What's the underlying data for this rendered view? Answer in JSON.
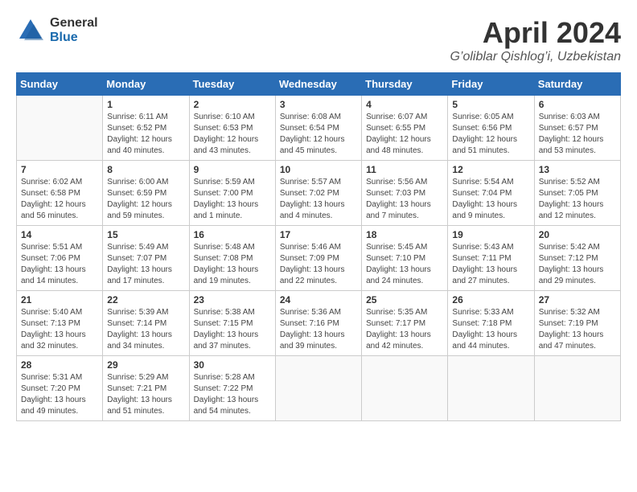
{
  "header": {
    "logo_general": "General",
    "logo_blue": "Blue",
    "month": "April 2024",
    "location": "G’oliblar Qishlog’i, Uzbekistan"
  },
  "days_of_week": [
    "Sunday",
    "Monday",
    "Tuesday",
    "Wednesday",
    "Thursday",
    "Friday",
    "Saturday"
  ],
  "weeks": [
    [
      {
        "day": "",
        "info": ""
      },
      {
        "day": "1",
        "info": "Sunrise: 6:11 AM\nSunset: 6:52 PM\nDaylight: 12 hours\nand 40 minutes."
      },
      {
        "day": "2",
        "info": "Sunrise: 6:10 AM\nSunset: 6:53 PM\nDaylight: 12 hours\nand 43 minutes."
      },
      {
        "day": "3",
        "info": "Sunrise: 6:08 AM\nSunset: 6:54 PM\nDaylight: 12 hours\nand 45 minutes."
      },
      {
        "day": "4",
        "info": "Sunrise: 6:07 AM\nSunset: 6:55 PM\nDaylight: 12 hours\nand 48 minutes."
      },
      {
        "day": "5",
        "info": "Sunrise: 6:05 AM\nSunset: 6:56 PM\nDaylight: 12 hours\nand 51 minutes."
      },
      {
        "day": "6",
        "info": "Sunrise: 6:03 AM\nSunset: 6:57 PM\nDaylight: 12 hours\nand 53 minutes."
      }
    ],
    [
      {
        "day": "7",
        "info": "Sunrise: 6:02 AM\nSunset: 6:58 PM\nDaylight: 12 hours\nand 56 minutes."
      },
      {
        "day": "8",
        "info": "Sunrise: 6:00 AM\nSunset: 6:59 PM\nDaylight: 12 hours\nand 59 minutes."
      },
      {
        "day": "9",
        "info": "Sunrise: 5:59 AM\nSunset: 7:00 PM\nDaylight: 13 hours\nand 1 minute."
      },
      {
        "day": "10",
        "info": "Sunrise: 5:57 AM\nSunset: 7:02 PM\nDaylight: 13 hours\nand 4 minutes."
      },
      {
        "day": "11",
        "info": "Sunrise: 5:56 AM\nSunset: 7:03 PM\nDaylight: 13 hours\nand 7 minutes."
      },
      {
        "day": "12",
        "info": "Sunrise: 5:54 AM\nSunset: 7:04 PM\nDaylight: 13 hours\nand 9 minutes."
      },
      {
        "day": "13",
        "info": "Sunrise: 5:52 AM\nSunset: 7:05 PM\nDaylight: 13 hours\nand 12 minutes."
      }
    ],
    [
      {
        "day": "14",
        "info": "Sunrise: 5:51 AM\nSunset: 7:06 PM\nDaylight: 13 hours\nand 14 minutes."
      },
      {
        "day": "15",
        "info": "Sunrise: 5:49 AM\nSunset: 7:07 PM\nDaylight: 13 hours\nand 17 minutes."
      },
      {
        "day": "16",
        "info": "Sunrise: 5:48 AM\nSunset: 7:08 PM\nDaylight: 13 hours\nand 19 minutes."
      },
      {
        "day": "17",
        "info": "Sunrise: 5:46 AM\nSunset: 7:09 PM\nDaylight: 13 hours\nand 22 minutes."
      },
      {
        "day": "18",
        "info": "Sunrise: 5:45 AM\nSunset: 7:10 PM\nDaylight: 13 hours\nand 24 minutes."
      },
      {
        "day": "19",
        "info": "Sunrise: 5:43 AM\nSunset: 7:11 PM\nDaylight: 13 hours\nand 27 minutes."
      },
      {
        "day": "20",
        "info": "Sunrise: 5:42 AM\nSunset: 7:12 PM\nDaylight: 13 hours\nand 29 minutes."
      }
    ],
    [
      {
        "day": "21",
        "info": "Sunrise: 5:40 AM\nSunset: 7:13 PM\nDaylight: 13 hours\nand 32 minutes."
      },
      {
        "day": "22",
        "info": "Sunrise: 5:39 AM\nSunset: 7:14 PM\nDaylight: 13 hours\nand 34 minutes."
      },
      {
        "day": "23",
        "info": "Sunrise: 5:38 AM\nSunset: 7:15 PM\nDaylight: 13 hours\nand 37 minutes."
      },
      {
        "day": "24",
        "info": "Sunrise: 5:36 AM\nSunset: 7:16 PM\nDaylight: 13 hours\nand 39 minutes."
      },
      {
        "day": "25",
        "info": "Sunrise: 5:35 AM\nSunset: 7:17 PM\nDaylight: 13 hours\nand 42 minutes."
      },
      {
        "day": "26",
        "info": "Sunrise: 5:33 AM\nSunset: 7:18 PM\nDaylight: 13 hours\nand 44 minutes."
      },
      {
        "day": "27",
        "info": "Sunrise: 5:32 AM\nSunset: 7:19 PM\nDaylight: 13 hours\nand 47 minutes."
      }
    ],
    [
      {
        "day": "28",
        "info": "Sunrise: 5:31 AM\nSunset: 7:20 PM\nDaylight: 13 hours\nand 49 minutes."
      },
      {
        "day": "29",
        "info": "Sunrise: 5:29 AM\nSunset: 7:21 PM\nDaylight: 13 hours\nand 51 minutes."
      },
      {
        "day": "30",
        "info": "Sunrise: 5:28 AM\nSunset: 7:22 PM\nDaylight: 13 hours\nand 54 minutes."
      },
      {
        "day": "",
        "info": ""
      },
      {
        "day": "",
        "info": ""
      },
      {
        "day": "",
        "info": ""
      },
      {
        "day": "",
        "info": ""
      }
    ]
  ]
}
